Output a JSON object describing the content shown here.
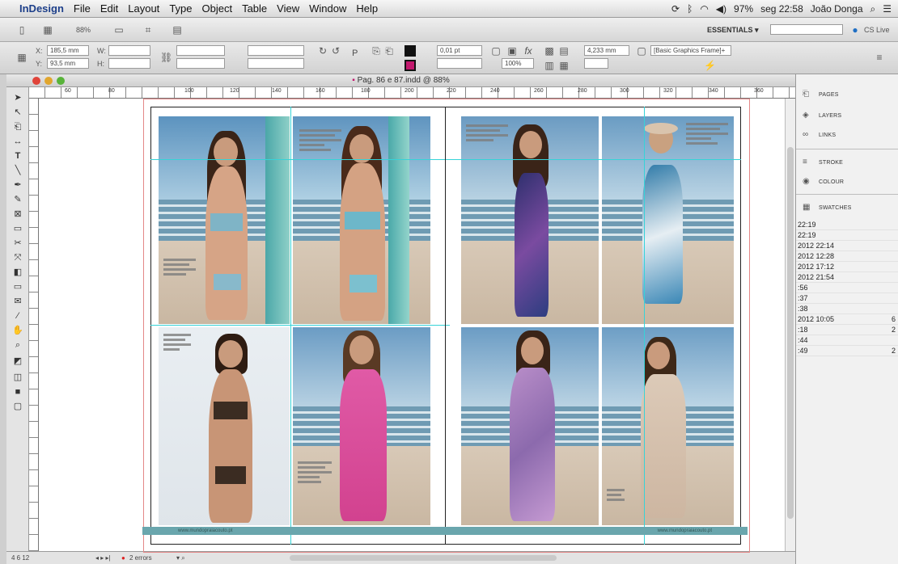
{
  "menubar": {
    "app": "InDesign",
    "items": [
      "File",
      "Edit",
      "Layout",
      "Type",
      "Object",
      "Table",
      "View",
      "Window",
      "Help"
    ],
    "battery": "97%",
    "clock": "seg 22:58",
    "user": "João Donga"
  },
  "appbar": {
    "zoom": "88%",
    "workspace": "ESSENTIALS ▾",
    "cslive": "CS Live"
  },
  "control": {
    "x": "185,5 mm",
    "y": "93,5 mm",
    "w_label": "W:",
    "h_label": "H:",
    "x_label": "X:",
    "y_label": "Y:",
    "stroke": "0,01 pt",
    "scale": "100%",
    "width2": "4,233 mm",
    "frame_style": "[Basic Graphics Frame]+"
  },
  "document": {
    "title": "Pag. 86 e 87.indd @ 88%",
    "ruler_ticks": [
      "60",
      "80",
      "100",
      "120",
      "140",
      "160",
      "180",
      "200",
      "220",
      "240",
      "260",
      "280",
      "300",
      "320",
      "340",
      "360",
      "380",
      "400"
    ],
    "ruler_left": [
      "40",
      "20"
    ],
    "footer_left": "www.mundopraiacouto.pt",
    "footer_right": "www.mundopraiacouto.pt",
    "page_number": "4 6 12",
    "errors": "2 errors"
  },
  "panel": {
    "items": [
      "PAGES",
      "LAYERS",
      "LINKS",
      "STROKE",
      "COLOUR",
      "SWATCHES"
    ],
    "times": [
      "22:19",
      "22:19",
      "2012 22:14",
      "2012 12:28",
      "2012 17:12",
      "2012 21:54",
      ":56",
      ":37",
      ":38",
      "2012 10:05",
      ":18",
      ":44",
      ":49"
    ],
    "side_numbers": [
      "6",
      "2",
      "2"
    ]
  },
  "colors": {
    "guide": "#36d3d8",
    "bleed": "#e48888",
    "title_accent": "#1d3f8a"
  }
}
